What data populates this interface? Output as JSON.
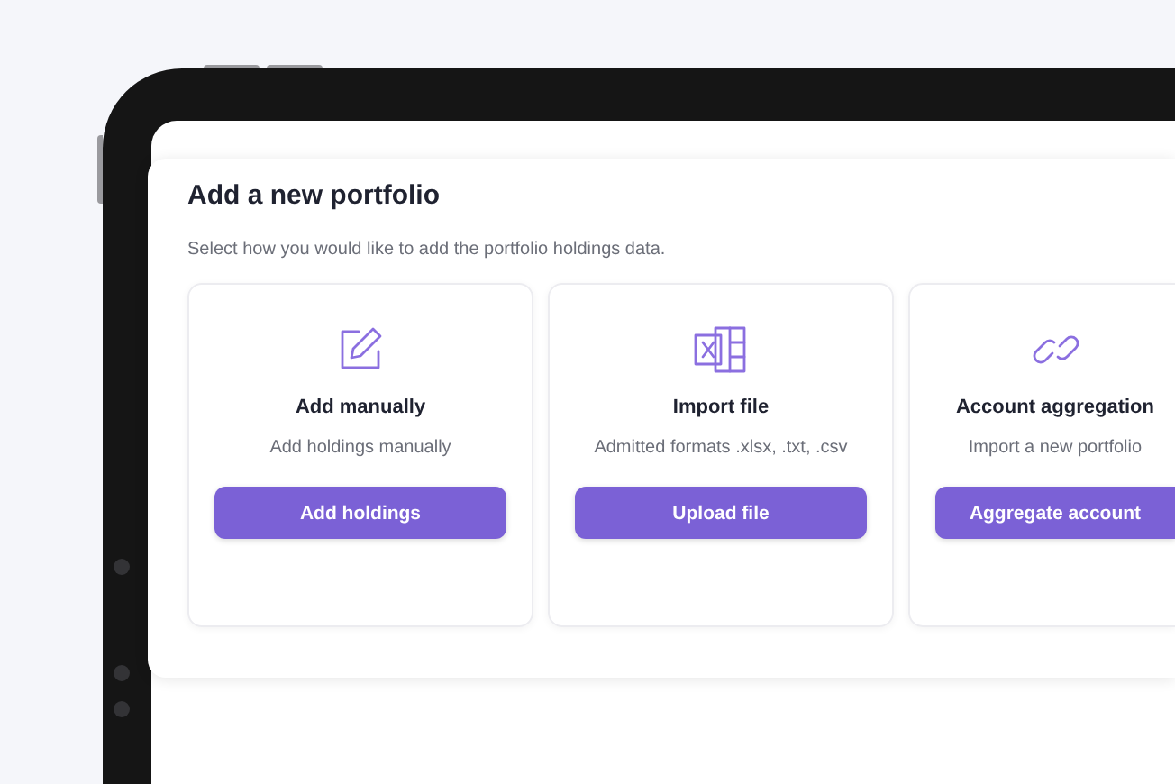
{
  "panel": {
    "title": "Add a new portfolio",
    "subtitle": "Select how you would like to add the portfolio holdings data."
  },
  "options": [
    {
      "title": "Add manually",
      "description": "Add holdings manually",
      "button": "Add holdings"
    },
    {
      "title": "Import file",
      "description": "Admitted formats .xlsx, .txt, .csv",
      "button": "Upload file"
    },
    {
      "title": "Account aggregation",
      "description": "Import a new portfolio",
      "button": "Aggregate account"
    }
  ]
}
